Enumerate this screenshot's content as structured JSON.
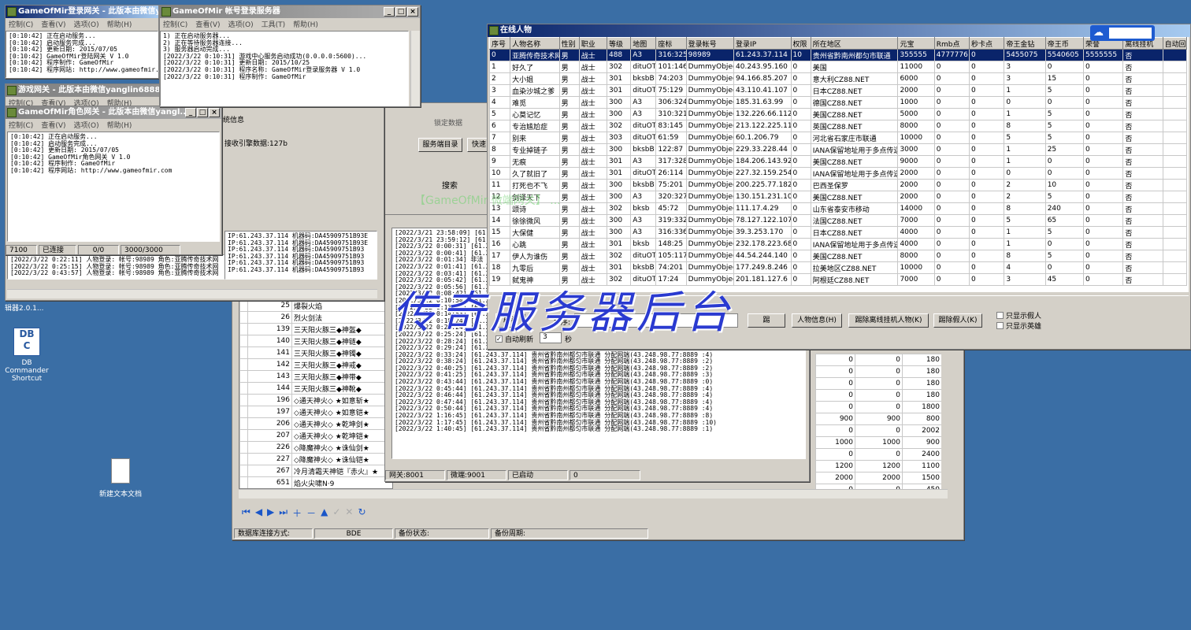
{
  "login_gw": {
    "title": "GameOfMir登录网关 - 此版本由微信ya...",
    "menu": [
      "控制(C)",
      "查看(V)",
      "选项(O)",
      "帮助(H)"
    ],
    "log": [
      "[0:10:42] 正在启动服务...",
      "[0:10:42] 启动服务完成...",
      "[0:10:42] 更新日期: 2015/07/05",
      "[0:10:42] GameOfMir登陆网关 V 1.0",
      "[0:10:42] 程序制作: GameOfMir",
      "[0:10:42] 程序网站: http://www.gameofmir."
    ]
  },
  "account_srv": {
    "title": "GameOfMir 帐号登录服务器",
    "menu": [
      "控制(C)",
      "查看(V)",
      "选项(O)",
      "工具(T)",
      "帮助(H)"
    ],
    "log": [
      "1) 正在启动服务器...",
      "2) 正在等待服务器连接...",
      "3) 服务器启动完成...",
      "[2022/3/22 0:10:31] 游戏中心服务启动成功(0.0.0.0:5600)...",
      "[2022/3/22 0:10:31] 更新日期: 2015/10/25",
      "[2022/3/22 0:10:31] 程序名称: GameOfMir登录服务器 V 1.0",
      "[2022/3/22 0:10:31] 程序制作: GameOfMir"
    ]
  },
  "game_gw": {
    "title": "游戏网关 - 此版本由微信yanglin688888制作(7200)",
    "menu": [
      "控制(C)",
      "查看(V)",
      "选项(O)",
      "帮助(H)"
    ],
    "partial": [
      "统信息",
      "接收引擎数据:127b"
    ],
    "status": [
      "7100",
      "已连接",
      "0/0",
      "3000/3000"
    ],
    "log": [
      "IP:61.243.37.114 机器码:DA45909751B93E",
      "IP:61.243.37.114 机器码:DA45909751B93E",
      "IP:61.243.37.114 机器码:DA45909751B93",
      "IP:61.243.37.114 机器码:DA45909751B93",
      "IP:61.243.37.114 机器码:DA45909751B93",
      "IP:61.243.37.114 机器码:DA45909751B93"
    ],
    "lower_log": [
      "[2022/3/22 0:22:11] 人物登录: 帐号:98989 角色:亚腾传奇技术网",
      "[2022/3/22 0:25:15] 人物登录: 帐号:98989 角色:亚腾传奇技术网",
      "[2022/3/22 0:43:57] 人物登录: 帐号:98989 角色:亚腾传奇技术网"
    ]
  },
  "role_gw": {
    "title": "GameOfMir角色网关 - 此版本由微信yangl...",
    "menu": [
      "控制(C)",
      "查看(V)",
      "选项(O)",
      "帮助(H)"
    ],
    "log": [
      "[0:10:42] 正在启动服务...",
      "[0:10:42] 启动服务完成...",
      "[0:10:42] 更新日期: 2015/07/05",
      "[0:10:42] GameOfMir角色网关 V 1.0",
      "[0:10:42] 程序制作: GameOfMir",
      "[0:10:42] 程序网站: http://www.gameofmir.com"
    ]
  },
  "dbc": {
    "version": "辑器2.0.1...",
    "tabs": [
      "锁定数据"
    ],
    "buttons": [
      "服务端目录",
      "快速"
    ],
    "search_label": "搜索",
    "filter_tab": "配置",
    "items": [
      {
        "id": "25",
        "name": "爆裂火焰"
      },
      {
        "id": "26",
        "name": "烈火剑法"
      },
      {
        "id": "139",
        "name": "三天阳火豚三◆神盔◆"
      },
      {
        "id": "140",
        "name": "三天阳火豚三◆神链◆"
      },
      {
        "id": "141",
        "name": "三天阳火豚三◆神镯◆"
      },
      {
        "id": "142",
        "name": "三天阳火豚三◆神戒◆"
      },
      {
        "id": "143",
        "name": "三天阳火豚三◆神带◆"
      },
      {
        "id": "144",
        "name": "三天阳火豚三◆神靴◆"
      },
      {
        "id": "196",
        "name": "◇通天神火◇ ★如意斩★"
      },
      {
        "id": "197",
        "name": "◇通天神火◇ ★如意铠★"
      },
      {
        "id": "206",
        "name": "◇通天神火◇ ★乾坤剑★"
      },
      {
        "id": "207",
        "name": "◇通天神火◇ ★乾坤铠★"
      },
      {
        "id": "226",
        "name": "◇降魔神火◇ ★诛仙剑★"
      },
      {
        "id": "227",
        "name": "◇降魔神火◇ ★诛仙铠★"
      },
      {
        "id": "267",
        "name": "冷月清霜天神铠『赤火』★"
      },
      {
        "id": "651",
        "name": "焰火尖啸N·9"
      },
      {
        "id": "927",
        "name": "辰光星火"
      }
    ],
    "right_cols": [
      [
        "0",
        "0",
        "180"
      ],
      [
        "0",
        "0",
        "180"
      ],
      [
        "0",
        "0",
        "180"
      ],
      [
        "0",
        "0",
        "180"
      ],
      [
        "0",
        "0",
        "1800"
      ],
      [
        "900",
        "900",
        "800"
      ],
      [
        "0",
        "0",
        "2002"
      ],
      [
        "1000",
        "1000",
        "900"
      ],
      [
        "0",
        "0",
        "2400"
      ],
      [
        "1200",
        "1200",
        "1100"
      ],
      [
        "2000",
        "2000",
        "1500"
      ],
      [
        "0",
        "0",
        "450"
      ],
      [
        "0",
        "0",
        "0"
      ]
    ],
    "status_labels": [
      "数据库连接方式:",
      "BDE",
      "备份状态:",
      "备份周期:"
    ]
  },
  "m2log": {
    "lines": [
      "[2022/3/21 23:58:09] [61.",
      "[2022/3/21 23:59:12] [61.",
      "[2022/3/22 0:00:31] [61.2",
      "[2022/3/22 0:00:41] [61.2",
      "[2022/3/22 0:01:34] 非法",
      "[2022/3/22 0:01:41] [61.2",
      "[2022/3/22 0:03:41] [61.2",
      "[2022/3/22 0:05:42] [61.2",
      "[2022/3/22 0:05:56] [61.2",
      "[2022/3/22 0:08:42] [61.2",
      "[2022/3/22 0:10:54] [61.2",
      "[2022/3/22 0:13:51] [61.2",
      "[2022/3/22 0:14:53] [61.2",
      "[2022/3/22 0:18:24] [61.2",
      "[2022/3/22 0:21:24] [61.2",
      "[2022/3/22 0:25:24] [61.2",
      "[2022/3/22 0:28:24] [61.243.37.114] 贵州省黔南州都匀市联通 分配网端(43.248.98.77:8889 :5)",
      "[2022/3/22 0:29:24] [61.243.37.114] 贵州省黔南州都匀市联通 分配网端(43.248.98.77:8889 :5)",
      "[2022/3/22 0:33:24] [61.243.37.114] 贵州省黔南州都匀市联通 分配网端(43.248.98.77:8889 :4)",
      "[2022/3/22 0:38:24] [61.243.37.114] 贵州省黔南州都匀市联通 分配网端(43.248.98.77:8889 :2)",
      "[2022/3/22 0:40:25] [61.243.37.114] 贵州省黔南州都匀市联通 分配网端(43.248.98.77:8889 :2)",
      "[2022/3/22 0:41:25] [61.243.37.114] 贵州省黔南州都匀市联通 分配网端(43.248.98.77:8889 :3)",
      "[2022/3/22 0:43:44] [61.243.37.114] 贵州省黔南州都匀市联通 分配网端(43.248.98.77:8889 :0)",
      "[2022/3/22 0:45:44] [61.243.37.114] 贵州省黔南州都匀市联通 分配网端(43.248.98.77:8889 :4)",
      "[2022/3/22 0:46:44] [61.243.37.114] 贵州省黔南州都匀市联通 分配网端(43.248.98.77:8889 :4)",
      "[2022/3/22 0:47:44] [61.243.37.114] 贵州省黔南州都匀市联通 分配网端(43.248.98.77:8889 :4)",
      "[2022/3/22 0:50:44] [61.243.37.114] 贵州省黔南州都匀市联通 分配网端(43.248.98.77:8889 :4)",
      "[2022/3/22 1:16:45] [61.243.37.114] 贵州省黔南州都匀市联通 分配网端(43.248.98.77:8889 :8)",
      "[2022/3/22 1:17:45] [61.243.37.114] 贵州省黔南州都匀市联通 分配网端(43.248.98.77:8889 :10)",
      "[2022/3/22 1:40:45] [61.243.37.114] 贵州省黔南州都匀市联通 分配网端(43.248.98.77:8889 :1)"
    ],
    "status": [
      "网关:8001",
      "微端:9001",
      "已启动",
      "0"
    ]
  },
  "online": {
    "title": "在线人物",
    "columns": [
      "序号",
      "人物名称",
      "性别",
      "职业",
      "等级",
      "地图",
      "座标",
      "登录帐号",
      "登录IP",
      "权限",
      "所在地区",
      "元宝",
      "Rmb点",
      "秒卡点",
      "帝王金钻",
      "帝王币",
      "荣誉",
      "离线挂机",
      "自动回"
    ],
    "rows": [
      [
        "0",
        "亚腾传奇技术网",
        "男",
        "战士",
        "488",
        "A3",
        "316:325",
        "98989",
        "61.243.37.114",
        "10",
        "贵州省黔南州都匀市联通",
        "355555",
        "4777776",
        "0",
        "5455075",
        "5540605",
        "5555555",
        "否",
        ""
      ],
      [
        "1",
        "好久了",
        "男",
        "战士",
        "302",
        "dituOT",
        "101:146",
        "DummyObject",
        "40.243.95.160",
        "0",
        "美国",
        "11000",
        "0",
        "0",
        "3",
        "0",
        "0",
        "否",
        ""
      ],
      [
        "2",
        "大小姐",
        "男",
        "战士",
        "301",
        "bksbB",
        "74:203",
        "DummyObject",
        "94.166.85.207",
        "0",
        "意大利CZ88.NET",
        "6000",
        "0",
        "0",
        "3",
        "15",
        "0",
        "否",
        ""
      ],
      [
        "3",
        "血染沙城之爹",
        "男",
        "战士",
        "301",
        "dituOT",
        "75:129",
        "DummyObject",
        "43.110.41.107",
        "0",
        "日本CZ88.NET",
        "2000",
        "0",
        "0",
        "1",
        "5",
        "0",
        "否",
        ""
      ],
      [
        "4",
        "难觅",
        "男",
        "战士",
        "300",
        "A3",
        "306:324",
        "DummyObject",
        "185.31.63.99",
        "0",
        "德国CZ88.NET",
        "1000",
        "0",
        "0",
        "0",
        "0",
        "0",
        "否",
        ""
      ],
      [
        "5",
        "心莫记忆",
        "男",
        "战士",
        "300",
        "A3",
        "310:321",
        "DummyObject",
        "132.226.66.112",
        "0",
        "美国CZ88.NET",
        "5000",
        "0",
        "0",
        "1",
        "5",
        "0",
        "否",
        ""
      ],
      [
        "6",
        "专治尴尬症",
        "男",
        "战士",
        "302",
        "dituOT",
        "83:145",
        "DummyObject",
        "213.122.225.112",
        "0",
        "英国CZ88.NET",
        "8000",
        "0",
        "0",
        "8",
        "5",
        "0",
        "否",
        ""
      ],
      [
        "7",
        "别来",
        "男",
        "战士",
        "303",
        "dituOT",
        "61:59",
        "DummyObject",
        "60.1.206.79",
        "0",
        "河北省石家庄市联通",
        "10000",
        "0",
        "0",
        "5",
        "5",
        "0",
        "否",
        ""
      ],
      [
        "8",
        "专业掉链子",
        "男",
        "战士",
        "300",
        "bksbB",
        "122:87",
        "DummyObject",
        "229.33.228.44",
        "0",
        "IANA保留地址用于多点传送",
        "3000",
        "0",
        "0",
        "1",
        "25",
        "0",
        "否",
        ""
      ],
      [
        "9",
        "无痕",
        "男",
        "战士",
        "301",
        "A3",
        "317:328",
        "DummyObject",
        "184.206.143.92",
        "0",
        "美国CZ88.NET",
        "9000",
        "0",
        "0",
        "1",
        "0",
        "0",
        "否",
        ""
      ],
      [
        "10",
        "久了就旧了",
        "男",
        "战士",
        "301",
        "dituOT",
        "26:114",
        "DummyObject",
        "227.32.159.254",
        "0",
        "IANA保留地址用于多点传送",
        "2000",
        "0",
        "0",
        "0",
        "0",
        "0",
        "否",
        ""
      ],
      [
        "11",
        "打死也不飞",
        "男",
        "战士",
        "300",
        "bksbB",
        "75:201",
        "DummyObject",
        "200.225.77.182",
        "0",
        "巴西圣保罗",
        "2000",
        "0",
        "0",
        "2",
        "10",
        "0",
        "否",
        ""
      ],
      [
        "12",
        "剑译天下",
        "男",
        "战士",
        "300",
        "A3",
        "320:327",
        "DummyObject",
        "130.151.231.103",
        "0",
        "美国CZ88.NET",
        "2000",
        "0",
        "0",
        "2",
        "5",
        "0",
        "否",
        ""
      ],
      [
        "13",
        "颂诗",
        "男",
        "战士",
        "302",
        "bksb",
        "45:72",
        "DummyObject",
        "111.17.4.29",
        "0",
        "山东省泰安市移动",
        "14000",
        "0",
        "0",
        "8",
        "240",
        "0",
        "否",
        ""
      ],
      [
        "14",
        "徐徐微风",
        "男",
        "战士",
        "300",
        "A3",
        "319:332",
        "DummyObject",
        "78.127.122.107",
        "0",
        "法国CZ88.NET",
        "7000",
        "0",
        "0",
        "5",
        "65",
        "0",
        "否",
        ""
      ],
      [
        "15",
        "大保健",
        "男",
        "战士",
        "300",
        "A3",
        "316:336",
        "DummyObject",
        "39.3.253.170",
        "0",
        "日本CZ88.NET",
        "4000",
        "0",
        "0",
        "1",
        "5",
        "0",
        "否",
        ""
      ],
      [
        "16",
        "心跳",
        "男",
        "战士",
        "301",
        "bksb",
        "148:25",
        "DummyObject",
        "232.178.223.68",
        "0",
        "IANA保留地址用于多点传送",
        "4000",
        "0",
        "0",
        "1",
        "0",
        "0",
        "否",
        ""
      ],
      [
        "17",
        "伊人为谁伤",
        "男",
        "战士",
        "302",
        "dituOT",
        "105:117",
        "DummyObject",
        "44.54.244.140",
        "0",
        "美国CZ88.NET",
        "8000",
        "0",
        "0",
        "8",
        "5",
        "0",
        "否",
        ""
      ],
      [
        "18",
        "九零后",
        "男",
        "战士",
        "301",
        "bksbB",
        "74:201",
        "DummyObject",
        "177.249.8.246",
        "0",
        "拉美地区CZ88.NET",
        "10000",
        "0",
        "0",
        "4",
        "0",
        "0",
        "否",
        ""
      ],
      [
        "19",
        "弑鬼神",
        "男",
        "战士",
        "302",
        "dituOT",
        "17:24",
        "DummyObject",
        "201.181.127.6",
        "0",
        "阿根廷CZ88.NET",
        "7000",
        "0",
        "0",
        "3",
        "45",
        "0",
        "否",
        ""
      ]
    ],
    "buttons": {
      "refresh": "刷新",
      "sort": "排序:",
      "kick": "踢",
      "info": "人物信息(H)",
      "kick_offline": "踢除离线挂机人物(K)",
      "kick_fake": "踢除假人(K)"
    },
    "auto_refresh": "自动刷新",
    "refresh_secs": "3",
    "secs_unit": "秒",
    "only_fake": "只显示假人",
    "only_hero": "只显示英雄"
  },
  "watermark": "传奇服务器后台",
  "ghost_text": "【GameOfMir 微端网关】 ...",
  "desktop": {
    "dbc_label": "DB Commander Shortcut",
    "doc_label": "新建文本文档"
  },
  "colors": {
    "desktop": "#3a6ea5",
    "selection": "#0a246a",
    "watermark": "#2a3ad0"
  }
}
